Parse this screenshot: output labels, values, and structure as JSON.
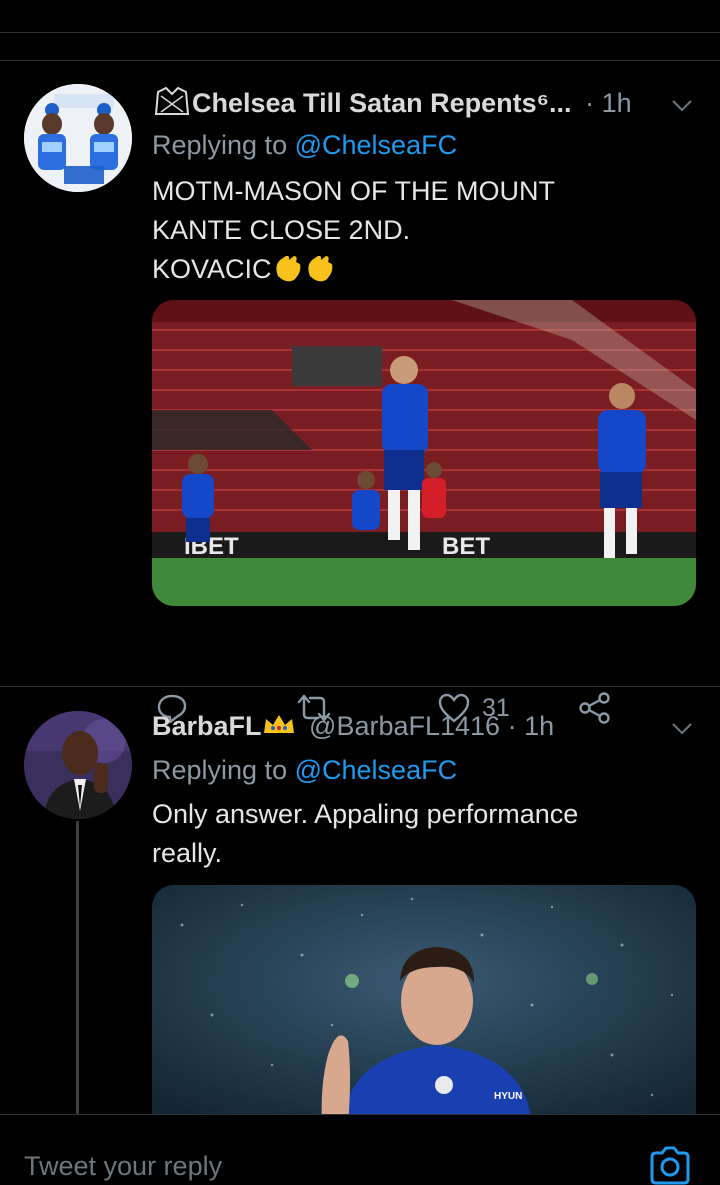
{
  "tweets": [
    {
      "name": "Chelsea Till Satan Repents⁶...",
      "time": "· 1h",
      "replying_label": "Replying to",
      "replying_to": "@ChelseaFC",
      "lines": [
        "MOTM-MASON OF THE MOUNT",
        "KANTE CLOSE 2ND.",
        "KOVACIC"
      ],
      "emoji": "clapping-hands",
      "actions": {
        "likes": "31"
      }
    },
    {
      "name": "BarbaFL",
      "handle": "@BarbaFL1416 · 1h",
      "replying_label": "Replying to",
      "replying_to": "@ChelseaFC",
      "lines": [
        "Only answer. Appaling performance",
        "really."
      ]
    }
  ],
  "compose": {
    "placeholder": "Tweet your reply"
  },
  "colors": {
    "accent": "#1d9bf0",
    "background": "#000000",
    "muted": "#8b98a5",
    "chelsea_blue": "#0a3fb8"
  }
}
